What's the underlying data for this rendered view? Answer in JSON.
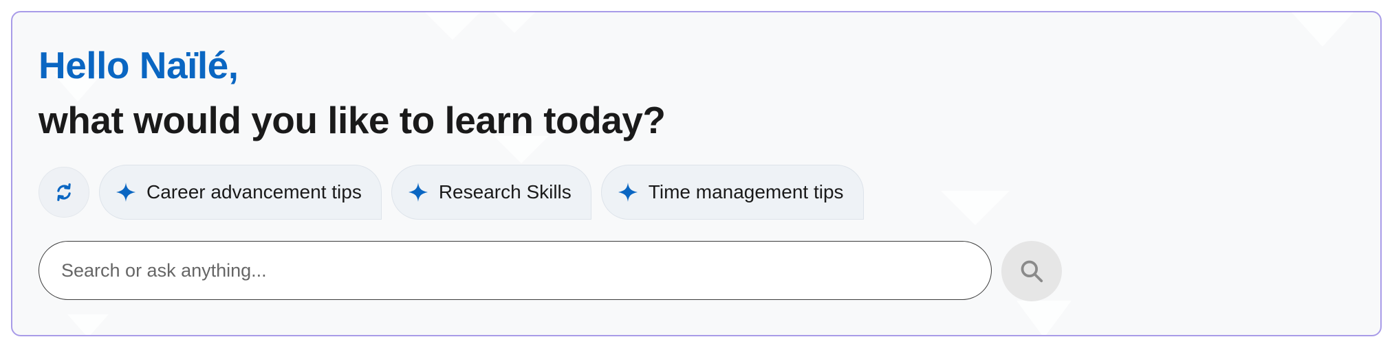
{
  "greeting": "Hello Naïlé,",
  "subtitle": "what would you like to learn today?",
  "suggestions": [
    {
      "label": "Career advancement tips",
      "icon": "sparkle-icon"
    },
    {
      "label": "Research Skills",
      "icon": "sparkle-icon"
    },
    {
      "label": "Time management tips",
      "icon": "sparkle-icon"
    }
  ],
  "refresh_icon": "refresh-icon",
  "search": {
    "placeholder": "Search or ask anything...",
    "value": "",
    "button_icon": "search-icon"
  },
  "colors": {
    "accent": "#0a66c2",
    "heading": "#1a1a1a",
    "card_border": "#a89be8",
    "card_background": "#f8f9fa",
    "chip_background": "#eef2f6",
    "search_button_background": "#e6e6e6"
  }
}
